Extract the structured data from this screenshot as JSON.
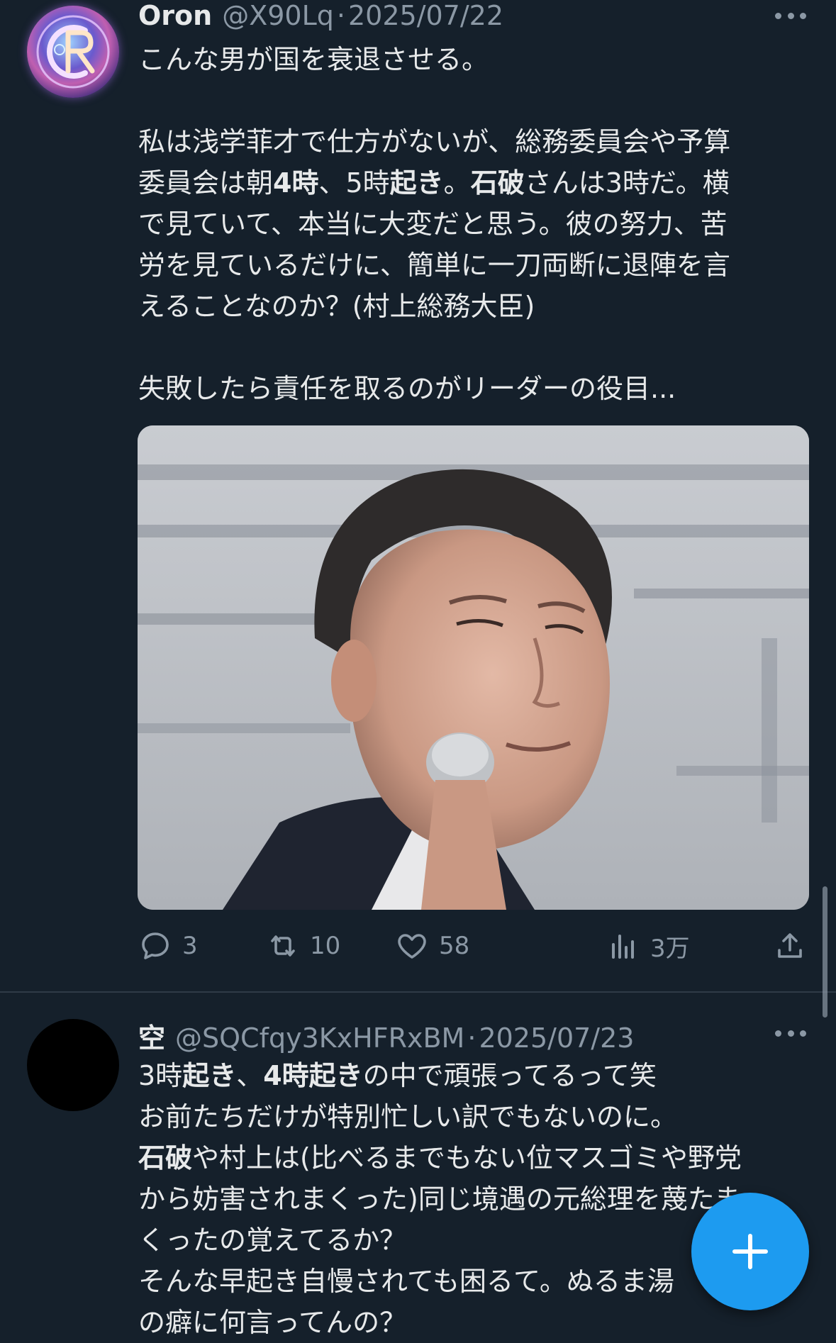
{
  "tweet1": {
    "name": "Oron",
    "handle": "@X90Lq",
    "date": "2025/07/22",
    "lines": [
      [
        {
          "t": "こんな男が国を衰退させる。"
        }
      ],
      [
        {
          "t": ""
        }
      ],
      [
        {
          "t": "私は浅学菲才で仕方がないが、総務委員会や予算"
        }
      ],
      [
        {
          "t": "委員会は朝"
        },
        {
          "t": "4時",
          "b": true
        },
        {
          "t": "、5時"
        },
        {
          "t": "起き",
          "b": true
        },
        {
          "t": "。"
        },
        {
          "t": "石破",
          "b": true
        },
        {
          "t": "さんは3時だ。横"
        }
      ],
      [
        {
          "t": "で見ていて、本当に大変だと思う。彼の努力、苦"
        }
      ],
      [
        {
          "t": "労を見ているだけに、簡単に一刀両断に退陣を言"
        }
      ],
      [
        {
          "t": "えることなのか？(村上総務大臣)"
        }
      ],
      [
        {
          "t": ""
        }
      ],
      [
        {
          "t": "失敗したら責任を取るのがリーダーの役目..."
        }
      ]
    ],
    "stats": {
      "replies": "3",
      "retweets": "10",
      "likes": "58",
      "views": "3万"
    }
  },
  "tweet2": {
    "name": "空",
    "handle": "@SQCfqy3KxHFRxBM",
    "date": "2025/07/23",
    "lines": [
      [
        {
          "t": "3時"
        },
        {
          "t": "起き",
          "b": true
        },
        {
          "t": "、"
        },
        {
          "t": "4時起き",
          "b": true
        },
        {
          "t": "の中で頑張ってるって笑"
        }
      ],
      [
        {
          "t": "お前たちだけが特別忙しい訳でもないのに。"
        }
      ],
      [
        {
          "t": "石破",
          "b": true
        },
        {
          "t": "や村上は(比べるまでもない位マスゴミや野党"
        }
      ],
      [
        {
          "t": "から妨害されまくった)同じ境遇の元総理を蔑たま"
        }
      ],
      [
        {
          "t": "くったの覚えてるか？"
        }
      ],
      [
        {
          "t": "そんな早起き自慢されても困るて。ぬるま湯"
        }
      ],
      [
        {
          "t": "の癖に何言ってんの？"
        }
      ]
    ]
  },
  "separator": "·",
  "colors": {
    "background": "#15202b",
    "text": "#e7e9ea",
    "muted": "#8b98a5",
    "accent": "#1d9bf0"
  },
  "icons": {
    "reply": "reply-icon",
    "retweet": "retweet-icon",
    "like": "heart-icon",
    "views": "views-icon",
    "share": "share-icon",
    "compose": "plus-icon",
    "more": "more-icon"
  }
}
